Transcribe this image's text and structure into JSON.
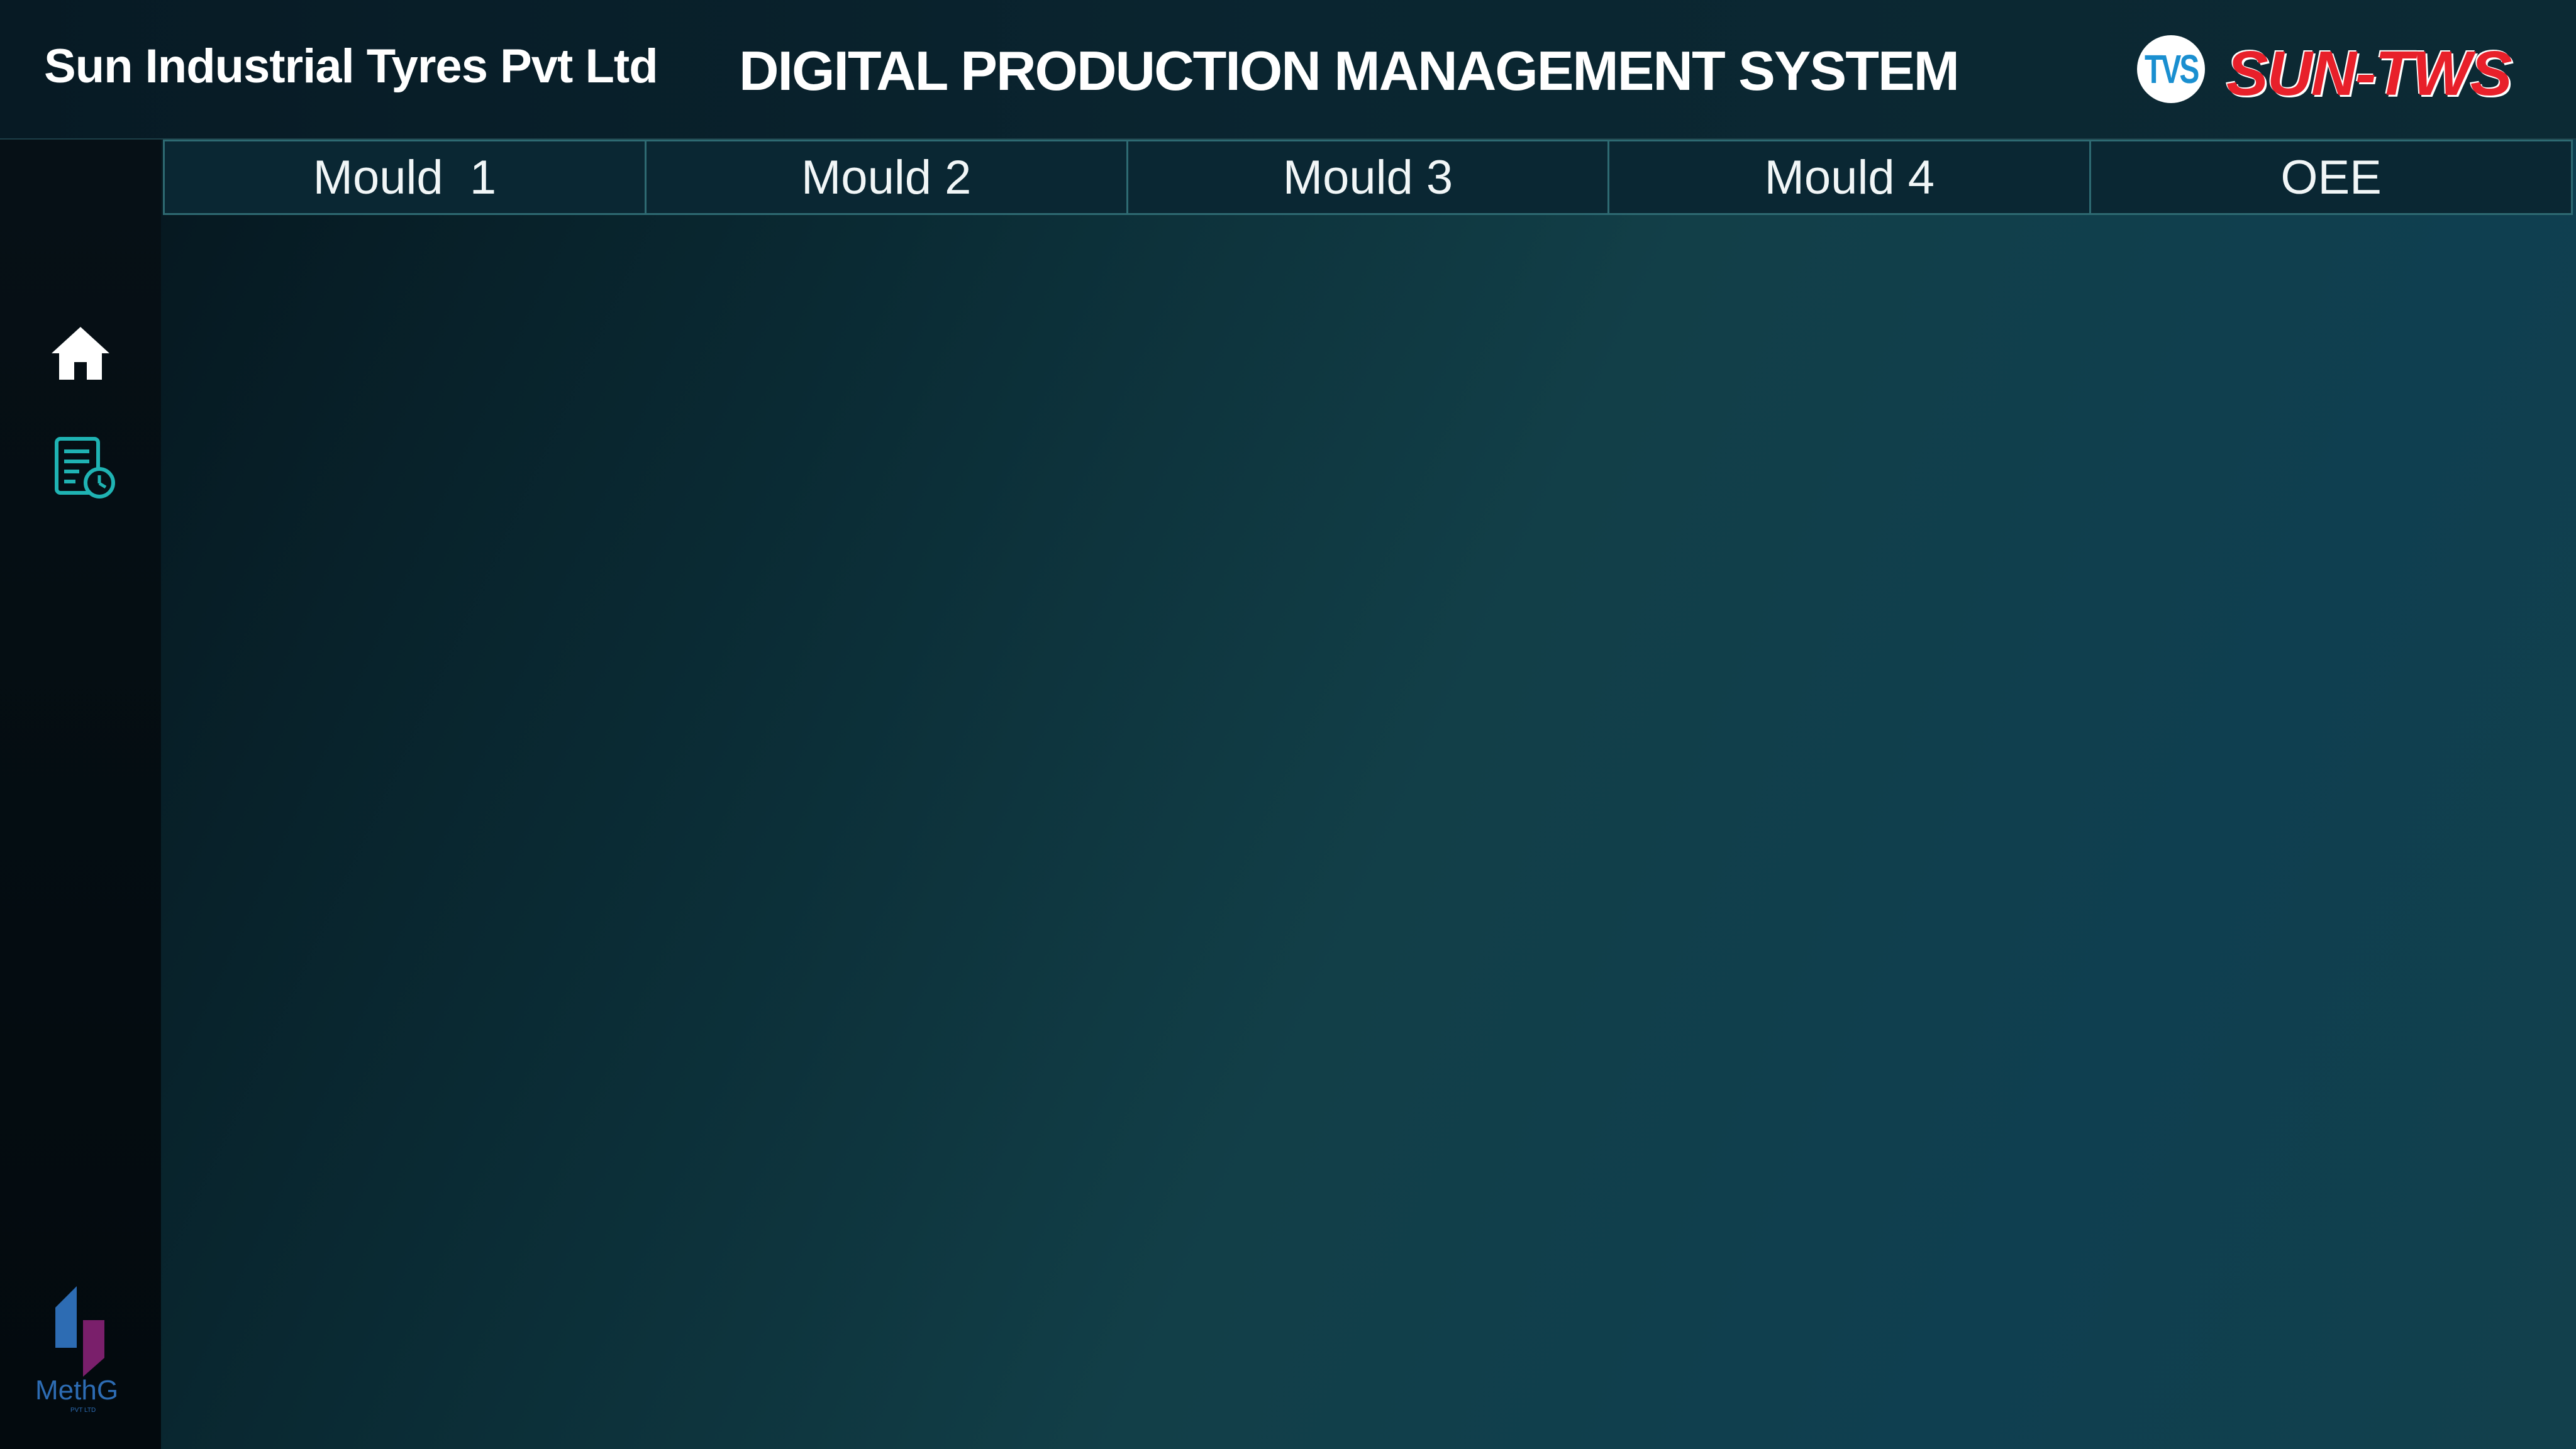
{
  "header": {
    "company": "Sun Industrial Tyres Pvt Ltd",
    "system_title": "DIGITAL PRODUCTION MANAGEMENT SYSTEM",
    "tvs_logo_text": "TVS",
    "brand_logo_text": "SUN-TWS"
  },
  "sidebar": {
    "items": [
      {
        "icon": "home-icon"
      },
      {
        "icon": "report-clock-icon"
      }
    ],
    "footer_logo": {
      "text": "MethG",
      "subtext": "PVT LTD"
    }
  },
  "tabs": [
    {
      "label": "Mould  1"
    },
    {
      "label": "Mould 2"
    },
    {
      "label": "Mould 3"
    },
    {
      "label": "Mould 4"
    },
    {
      "label": "OEE"
    }
  ],
  "colors": {
    "accent_border": "#2e6a72",
    "brand_red": "#e8202a",
    "tvs_blue": "#1a8fd0",
    "icon_teal": "#1fb3b3",
    "methg_blue": "#2d6cb3",
    "methg_purple": "#7a1f6b"
  }
}
